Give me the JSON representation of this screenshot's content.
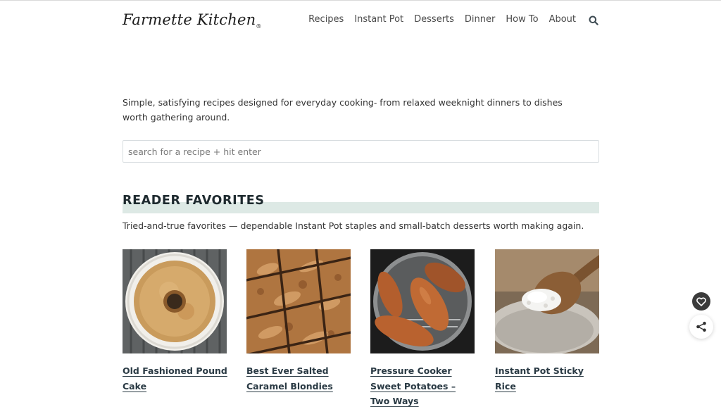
{
  "header": {
    "logo_text": "Farmette Kitchen",
    "logo_mark": "®",
    "nav": [
      {
        "label": "Recipes"
      },
      {
        "label": "Instant Pot"
      },
      {
        "label": "Desserts"
      },
      {
        "label": "Dinner"
      },
      {
        "label": "How To"
      },
      {
        "label": "About"
      }
    ],
    "search_icon": "search-icon"
  },
  "intro": {
    "text": "Simple, satisfying recipes designed for everyday cooking- from relaxed weeknight dinners to dishes worth gathering around."
  },
  "search": {
    "placeholder": "search for a recipe + hit enter",
    "value": ""
  },
  "favorites": {
    "heading": "READER FAVORITES",
    "description": "Tried-and-true favorites — dependable Instant Pot staples and small-batch desserts worth making again.",
    "accent_color": "#dde9e5",
    "cards": [
      {
        "title": "Old Fashioned Pound Cake",
        "image": "pound-cake-image"
      },
      {
        "title": "Best Ever Salted Caramel Blondies",
        "image": "blondies-image"
      },
      {
        "title": "Pressure Cooker Sweet Potatoes – Two Ways",
        "image": "sweet-potatoes-image"
      },
      {
        "title": "Instant Pot Sticky Rice",
        "image": "sticky-rice-image"
      }
    ]
  },
  "floating": {
    "favorite_icon": "heart-icon",
    "share_icon": "share-icon"
  }
}
